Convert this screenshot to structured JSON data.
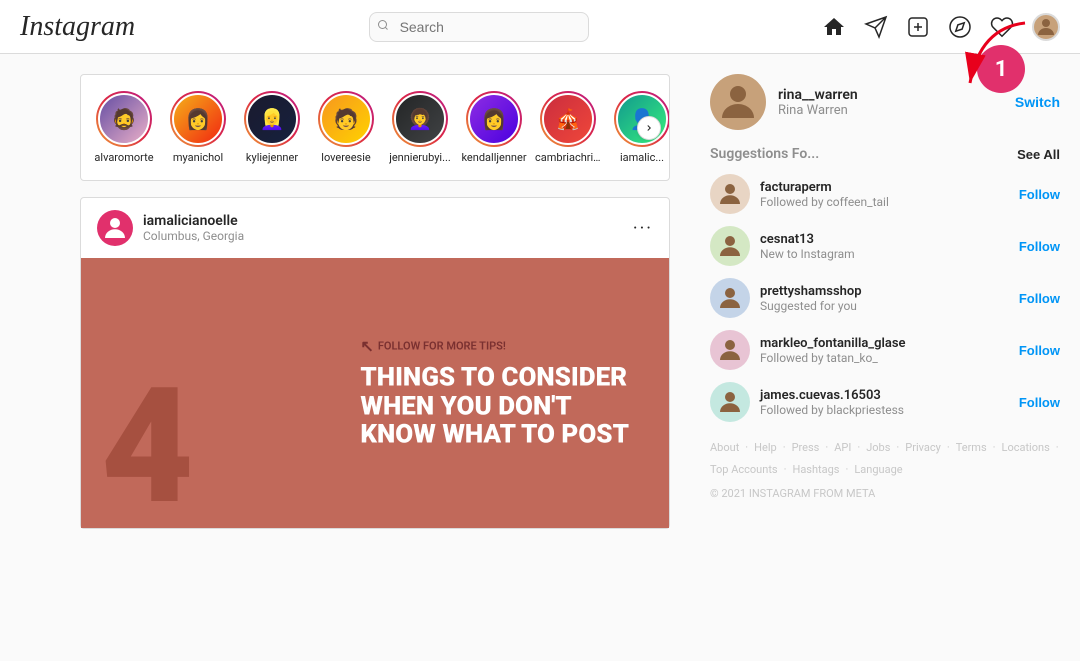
{
  "header": {
    "logo": "Instagram",
    "search_placeholder": "Search"
  },
  "stories": {
    "items": [
      {
        "id": 1,
        "label": "alvaromorte",
        "emoji": "🧔"
      },
      {
        "id": 2,
        "label": "myanichol",
        "emoji": "👩"
      },
      {
        "id": 3,
        "label": "kyliejenner",
        "emoji": "👱‍♀️"
      },
      {
        "id": 4,
        "label": "lovereesie",
        "emoji": "🧑"
      },
      {
        "id": 5,
        "label": "jennierubyi...",
        "emoji": "👩‍🦱"
      },
      {
        "id": 6,
        "label": "kendalljenner",
        "emoji": "👩"
      },
      {
        "id": 7,
        "label": "cambriachri...",
        "emoji": "🎪"
      },
      {
        "id": 8,
        "label": "iamalic...",
        "emoji": "👤"
      }
    ]
  },
  "post": {
    "username": "iamalicianoelle",
    "location": "Columbus, Georgia",
    "follow_text": "FOLLOW FOR MORE TIPS!",
    "big_number": "4",
    "title_line1": "THINGS TO CONSIDER",
    "title_line2": "WHEN YOU DON'T",
    "title_line3": "KNOW WHAT TO POST"
  },
  "sidebar": {
    "profile": {
      "username": "rina__warren",
      "name": "Rina Warren",
      "switch_label": "Switch"
    },
    "suggestions_title": "Suggestions Fo...",
    "see_all_label": "See All",
    "suggestions": [
      {
        "id": 1,
        "username": "facturaperm",
        "subtitle": "Followed by coffeen_tail",
        "follow_label": "Follow",
        "color": "sav1"
      },
      {
        "id": 2,
        "username": "cesnat13",
        "subtitle": "New to Instagram",
        "follow_label": "Follow",
        "color": "sav2"
      },
      {
        "id": 3,
        "username": "prettyshamsshop",
        "subtitle": "Suggested for you",
        "follow_label": "Follow",
        "color": "sav3"
      },
      {
        "id": 4,
        "username": "markleo_fontanilla_glase",
        "subtitle": "Followed by tatan_ko_",
        "follow_label": "Follow",
        "color": "sav4"
      },
      {
        "id": 5,
        "username": "james.cuevas.16503",
        "subtitle": "Followed by blackpriestess",
        "follow_label": "Follow",
        "color": "sav5"
      }
    ],
    "footer": {
      "links": [
        "About",
        "Help",
        "Press",
        "API",
        "Jobs",
        "Privacy",
        "Terms",
        "Locations",
        "Top Accounts",
        "Hashtags",
        "Language"
      ],
      "copyright": "© 2021 INSTAGRAM FROM META"
    }
  },
  "notification": {
    "badge_number": "1"
  }
}
